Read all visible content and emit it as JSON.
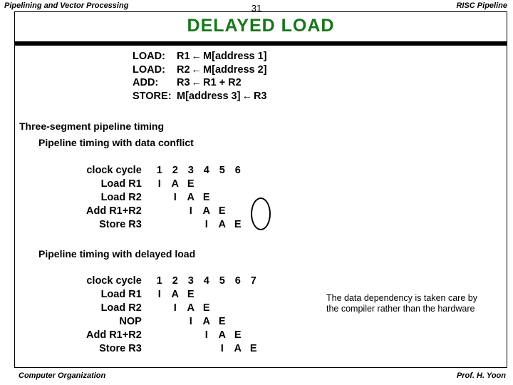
{
  "header": {
    "left": "Pipelining and Vector Processing",
    "page": "31",
    "right": "RISC Pipeline"
  },
  "title": {
    "text": "DELAYED  LOAD",
    "color": "#17761b"
  },
  "code_block": [
    {
      "label": "LOAD:",
      "dest": "R1",
      "arrow": "←",
      "src": "M[address 1]"
    },
    {
      "label": "LOAD:",
      "dest": "R2",
      "arrow": "←",
      "src": "M[address 2]"
    },
    {
      "label": "ADD:",
      "dest": "R3",
      "arrow": "←",
      "src": "R1 + R2"
    },
    {
      "label": "STORE:",
      "dest": "M[address 3]",
      "arrow": "←",
      "src": "R3"
    }
  ],
  "headings": {
    "main": "Three-segment pipeline timing",
    "sub1": "Pipeline timing with data conflict",
    "sub2": "Pipeline timing with delayed load"
  },
  "table1": {
    "header_label": "clock cycle",
    "cycles": [
      "1",
      "2",
      "3",
      "4",
      "5",
      "6"
    ],
    "rows": [
      {
        "label": "Load  R1",
        "cells": [
          "I",
          "A",
          "E",
          "",
          "",
          ""
        ]
      },
      {
        "label": "Load  R2",
        "cells": [
          "",
          "I",
          "A",
          "E",
          "",
          ""
        ]
      },
      {
        "label": "Add   R1+R2",
        "cells": [
          "",
          "",
          "I",
          "A",
          "E",
          ""
        ]
      },
      {
        "label": "Store  R3",
        "cells": [
          "",
          "",
          "",
          "I",
          "A",
          "E"
        ]
      }
    ]
  },
  "table2": {
    "header_label": "clock cycle",
    "cycles": [
      "1",
      "2",
      "3",
      "4",
      "5",
      "6",
      "7"
    ],
    "rows": [
      {
        "label": "Load   R1",
        "cells": [
          "I",
          "A",
          "E",
          "",
          "",
          "",
          ""
        ]
      },
      {
        "label": "Load   R2",
        "cells": [
          "",
          "I",
          "A",
          "E",
          "",
          "",
          ""
        ]
      },
      {
        "label": "NOP",
        "cells": [
          "",
          "",
          "I",
          "A",
          "E",
          "",
          ""
        ]
      },
      {
        "label": "Add  R1+R2",
        "cells": [
          "",
          "",
          "",
          "I",
          "A",
          "E",
          ""
        ]
      },
      {
        "label": "Store   R3",
        "cells": [
          "",
          "",
          "",
          "",
          "I",
          "A",
          "E"
        ]
      }
    ]
  },
  "note": "The data dependency is taken care by the compiler rather than the hardware",
  "footer": {
    "left": "Computer Organization",
    "right": "Prof.  H. Yoon"
  }
}
